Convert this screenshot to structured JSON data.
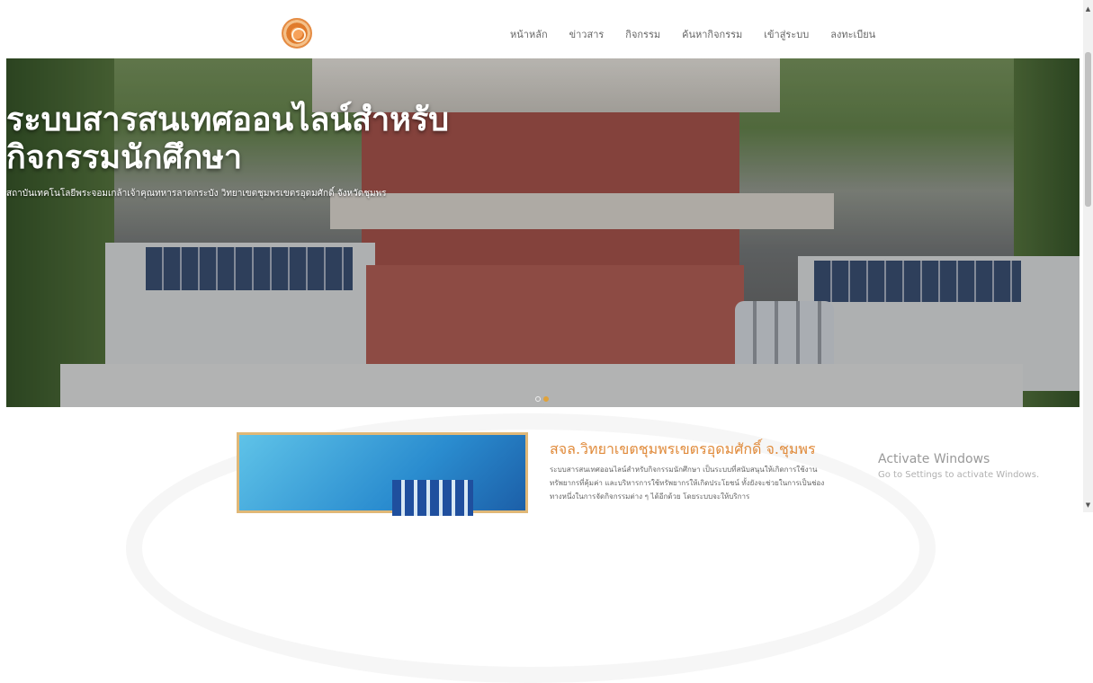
{
  "nav": {
    "logo_icon": "university-seal-icon",
    "items": [
      "หน้าหลัก",
      "ข่าวสาร",
      "กิจกรรม",
      "ค้นหากิจกรรม",
      "เข้าสู่ระบบ",
      "ลงทะเบียน"
    ]
  },
  "hero": {
    "title_line1": "ระบบสารสนเทศออนไลน์สำหรับ",
    "title_line2": "กิจกรรมนักศึกษา",
    "subtitle": "สถาบันเทคโนโลยีพระจอมเกล้าเจ้าคุณทหารลาดกระบัง วิทยาเขตชุมพรเขตรอุดมศักดิ์ จังหวัดชุมพร",
    "slides_count": 2,
    "active_slide": 2
  },
  "about": {
    "title": "สจล.วิทยาเขตชุมพรเขตรอุดมศักดิ์ จ.ชุมพร",
    "body": "ระบบสารสนเทศออนไลน์สำหรับกิจกรรมนักศึกษา เป็นระบบที่สนับสนุนให้เกิดการใช้งานทรัพยากรที่คุ้มค่า และบริหารการใช้ทรัพยากรให้เกิดประโยชน์ ทั้งยังจะช่วยในการเป็นช่องทางหนึ่งในการจัดกิจกรรมต่าง ๆ ได้อีกด้วย โดยระบบจะให้บริการ"
  },
  "windows_watermark": {
    "line1": "Activate Windows",
    "line2": "Go to Settings to activate Windows."
  },
  "colors": {
    "accent": "#e08a3a",
    "nav_text": "#666666"
  }
}
